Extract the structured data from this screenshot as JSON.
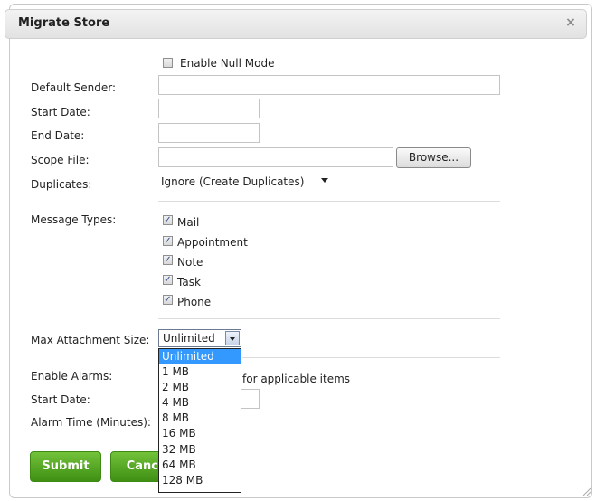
{
  "dialog": {
    "title": "Migrate Store",
    "close_glyph": "×"
  },
  "form": {
    "null_mode_label": "Enable Null Mode",
    "default_sender_label": "Default Sender:",
    "default_sender_value": "",
    "start_date_label": "Start Date:",
    "start_date_value": "",
    "end_date_label": "End Date:",
    "end_date_value": "",
    "scope_file_label": "Scope File:",
    "scope_file_value": "",
    "browse_label": "Browse...",
    "duplicates_label": "Duplicates:",
    "duplicates_value": "Ignore (Create Duplicates)",
    "message_types_label": "Message Types:",
    "message_types": [
      {
        "label": "Mail",
        "checked": true
      },
      {
        "label": "Appointment",
        "checked": true
      },
      {
        "label": "Note",
        "checked": true
      },
      {
        "label": "Task",
        "checked": true
      },
      {
        "label": "Phone",
        "checked": true
      }
    ],
    "max_attachment_label": "Max Attachment Size:",
    "max_attachment_value": "Unlimited",
    "max_attachment_options": [
      "Unlimited",
      "1 MB",
      "2 MB",
      "4 MB",
      "8 MB",
      "16 MB",
      "32 MB",
      "64 MB",
      "128 MB"
    ],
    "enable_alarms_label": "Enable Alarms:",
    "enable_alarms_text": "for applicable items",
    "alarm_start_date_label": "Start Date:",
    "alarm_time_label": "Alarm Time (Minutes):",
    "checkmark_glyph": "✓"
  },
  "buttons": {
    "submit": "Submit",
    "cancel": "Cancel"
  },
  "colors": {
    "accent_green": "#4a9e1c",
    "selection_blue": "#3399ff"
  }
}
